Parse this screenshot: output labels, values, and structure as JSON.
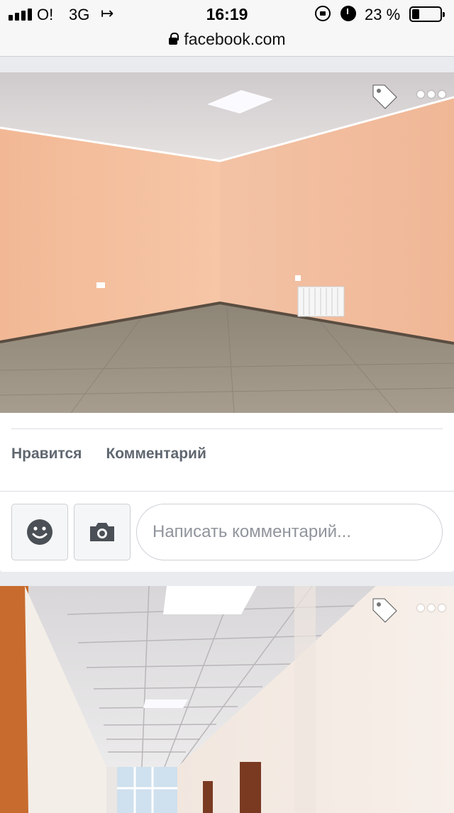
{
  "status_bar": {
    "carrier": "O!",
    "network": "3G",
    "call_forward_glyph": "↦",
    "time": "16:19",
    "battery_percent": "23 %",
    "battery_level": 0.23,
    "signal_bars": 4,
    "icons": [
      "signal-icon",
      "call-forward-icon",
      "orientation-lock-icon",
      "alarm-icon",
      "battery-icon"
    ]
  },
  "address_bar": {
    "url": "facebook.com",
    "secure": true
  },
  "posts": [
    {
      "photo_alt": "",
      "actions": {
        "like": "Нравится",
        "comment": "Комментарий"
      },
      "comment_box": {
        "placeholder": "Написать комментарий..."
      },
      "icons": [
        "tag-icon",
        "more-icon",
        "emoji-icon",
        "camera-icon"
      ]
    },
    {
      "photo_alt": "",
      "icons": [
        "tag-icon",
        "more-icon"
      ]
    }
  ],
  "colors": {
    "action_text": "#606770",
    "placeholder": "#90949c",
    "feed_bg": "#e9ebee",
    "icon_blue": "#4b4f56"
  }
}
